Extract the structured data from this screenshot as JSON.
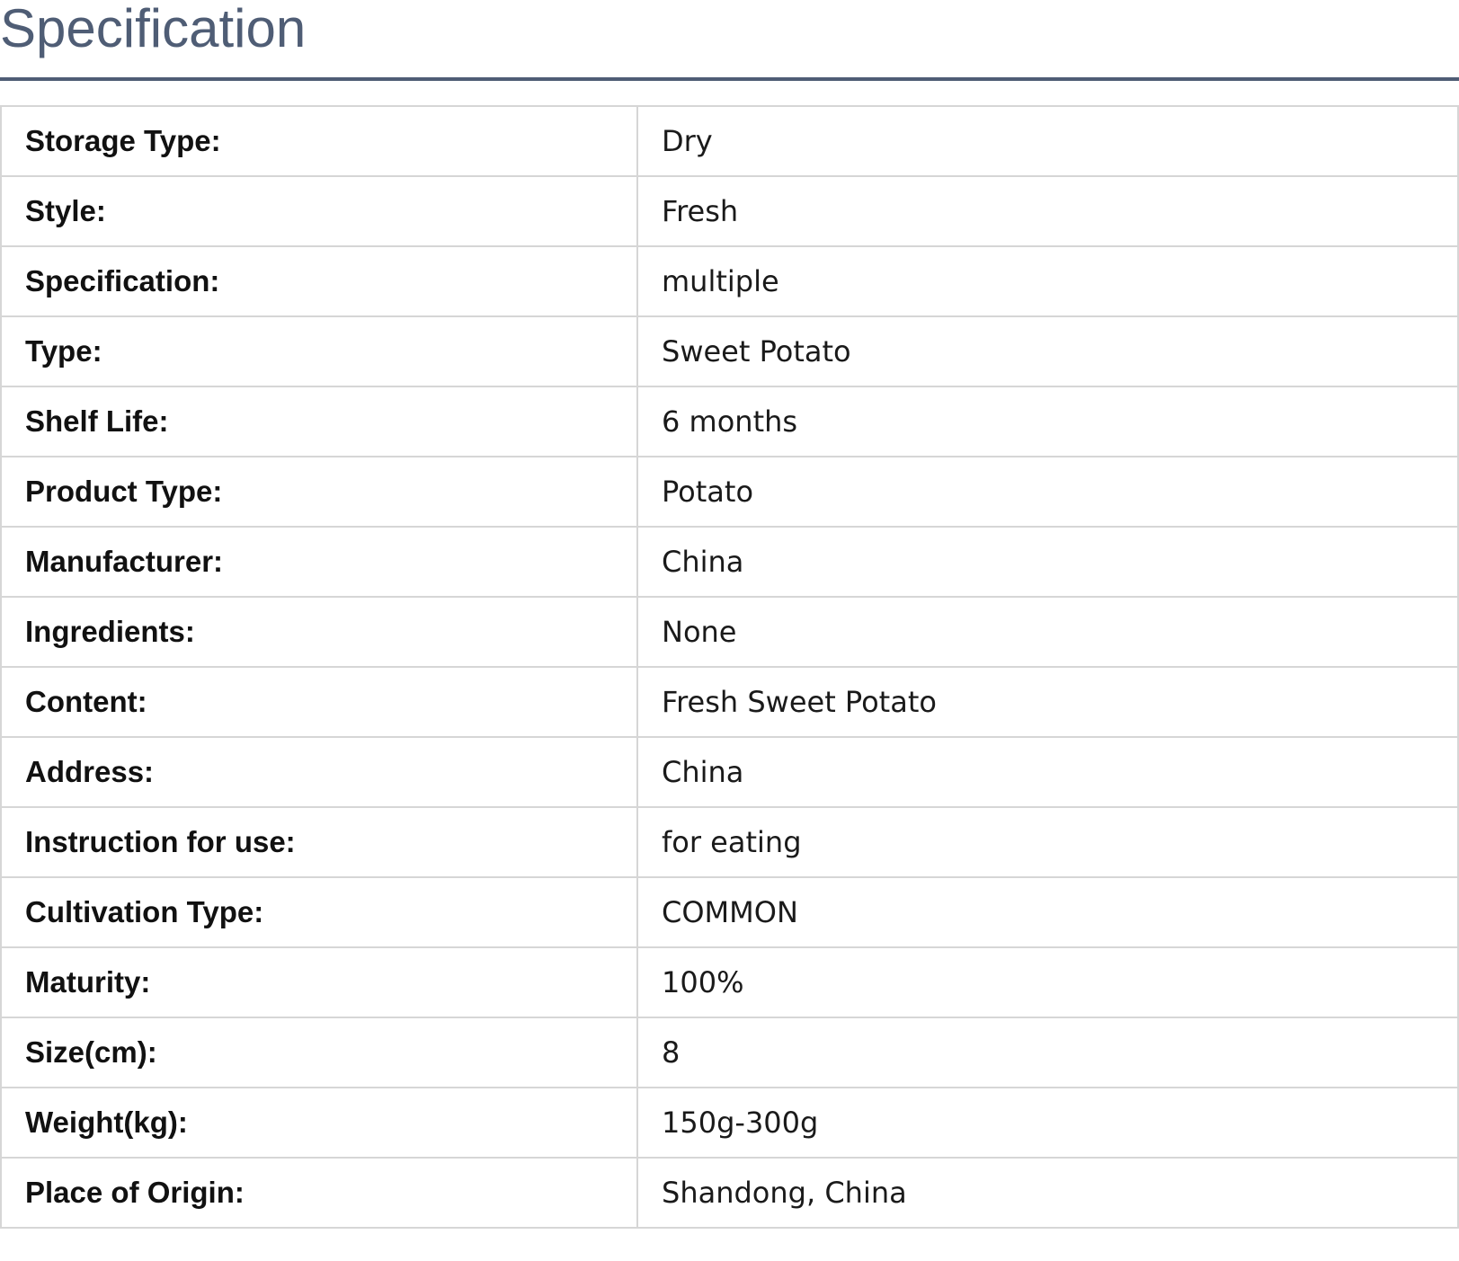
{
  "page": {
    "title": "Specification"
  },
  "specs": [
    {
      "label": "Storage Type:",
      "value": "Dry"
    },
    {
      "label": "Style:",
      "value": "Fresh"
    },
    {
      "label": "Specification:",
      "value": "multiple"
    },
    {
      "label": "Type:",
      "value": "Sweet Potato"
    },
    {
      "label": "Shelf Life:",
      "value": "6 months"
    },
    {
      "label": "Product Type:",
      "value": "Potato"
    },
    {
      "label": "Manufacturer:",
      "value": "China"
    },
    {
      "label": "Ingredients:",
      "value": "None"
    },
    {
      "label": "Content:",
      "value": "Fresh Sweet Potato"
    },
    {
      "label": "Address:",
      "value": "China"
    },
    {
      "label": "Instruction for use:",
      "value": "for eating"
    },
    {
      "label": "Cultivation Type:",
      "value": "COMMON"
    },
    {
      "label": "Maturity:",
      "value": "100%"
    },
    {
      "label": "Size(cm):",
      "value": "8"
    },
    {
      "label": "Weight(kg):",
      "value": "150g-300g"
    },
    {
      "label": "Place of Origin:",
      "value": "Shandong, China"
    }
  ],
  "colors": {
    "title": "#4f5d75",
    "rule": "#4f5d75",
    "border": "#d6d6d6"
  }
}
